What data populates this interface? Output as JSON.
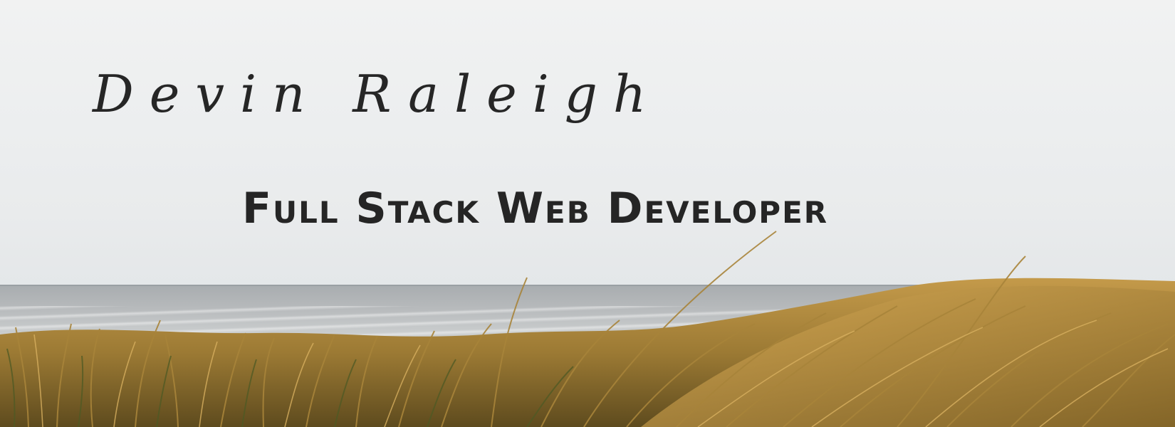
{
  "header": {
    "name": "Devin Raleigh",
    "tagline": "Full Stack Web Developer"
  },
  "background": {
    "scene": "seaside-dunes-photo",
    "colors": {
      "sky": "#eceeef",
      "sea": "#b6b9bb",
      "grass_gold": "#b8893a",
      "grass_dark": "#6b5a24",
      "text": "#262626"
    }
  }
}
